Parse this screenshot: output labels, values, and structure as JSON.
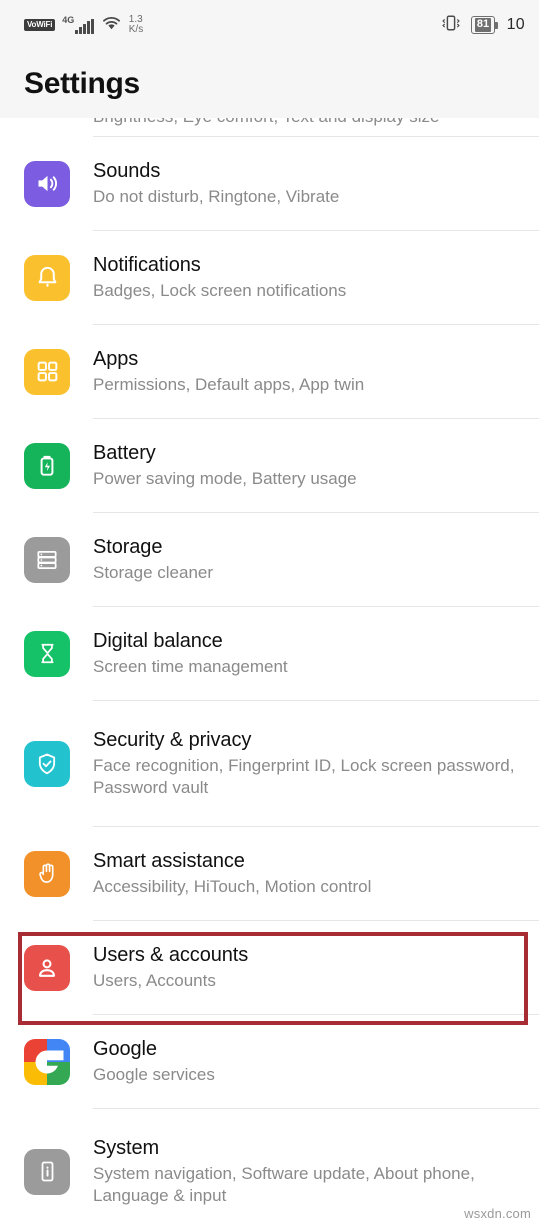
{
  "statusbar": {
    "vowifi_label": "VoWiFi",
    "network_label": "4G",
    "datarate_value": "1.3",
    "datarate_unit": "K/s",
    "battery_percent": "81",
    "time": "10"
  },
  "header": {
    "title": "Settings"
  },
  "clipped_top_row": {
    "sub": "Brightness, Eye comfort, Text and display size"
  },
  "watermark": "wsxdn.com",
  "highlight": {
    "color": "#a82c33",
    "target": "Users & accounts"
  },
  "list": {
    "items": [
      {
        "title": "Sounds",
        "sub": "Do not disturb, Ringtone, Vibrate",
        "icon": "speaker-icon",
        "color": "#7c5ce0"
      },
      {
        "title": "Notifications",
        "sub": "Badges, Lock screen notifications",
        "icon": "bell-icon",
        "color": "#fbc02d"
      },
      {
        "title": "Apps",
        "sub": "Permissions, Default apps, App twin",
        "icon": "apps-grid-icon",
        "color": "#fbc02d"
      },
      {
        "title": "Battery",
        "sub": "Power saving mode, Battery usage",
        "icon": "battery-icon",
        "color": "#16b45a"
      },
      {
        "title": "Storage",
        "sub": "Storage cleaner",
        "icon": "storage-icon",
        "color": "#9b9b9b"
      },
      {
        "title": "Digital balance",
        "sub": "Screen time management",
        "icon": "hourglass-icon",
        "color": "#16c267"
      },
      {
        "title": "Security & privacy",
        "sub": "Face recognition, Fingerprint ID, Lock screen password, Password vault",
        "icon": "shield-check-icon",
        "color": "#22c3cf"
      },
      {
        "title": "Smart assistance",
        "sub": "Accessibility, HiTouch, Motion control",
        "icon": "hand-icon",
        "color": "#f29029"
      },
      {
        "title": "Users & accounts",
        "sub": "Users, Accounts",
        "icon": "user-icon",
        "color": "#e8514b"
      },
      {
        "title": "Google",
        "sub": "Google services",
        "icon": "google-icon",
        "color": "#ffffff"
      },
      {
        "title": "System",
        "sub": "System navigation, Software update, About phone, Language & input",
        "icon": "system-info-icon",
        "color": "#9b9b9b"
      }
    ]
  }
}
